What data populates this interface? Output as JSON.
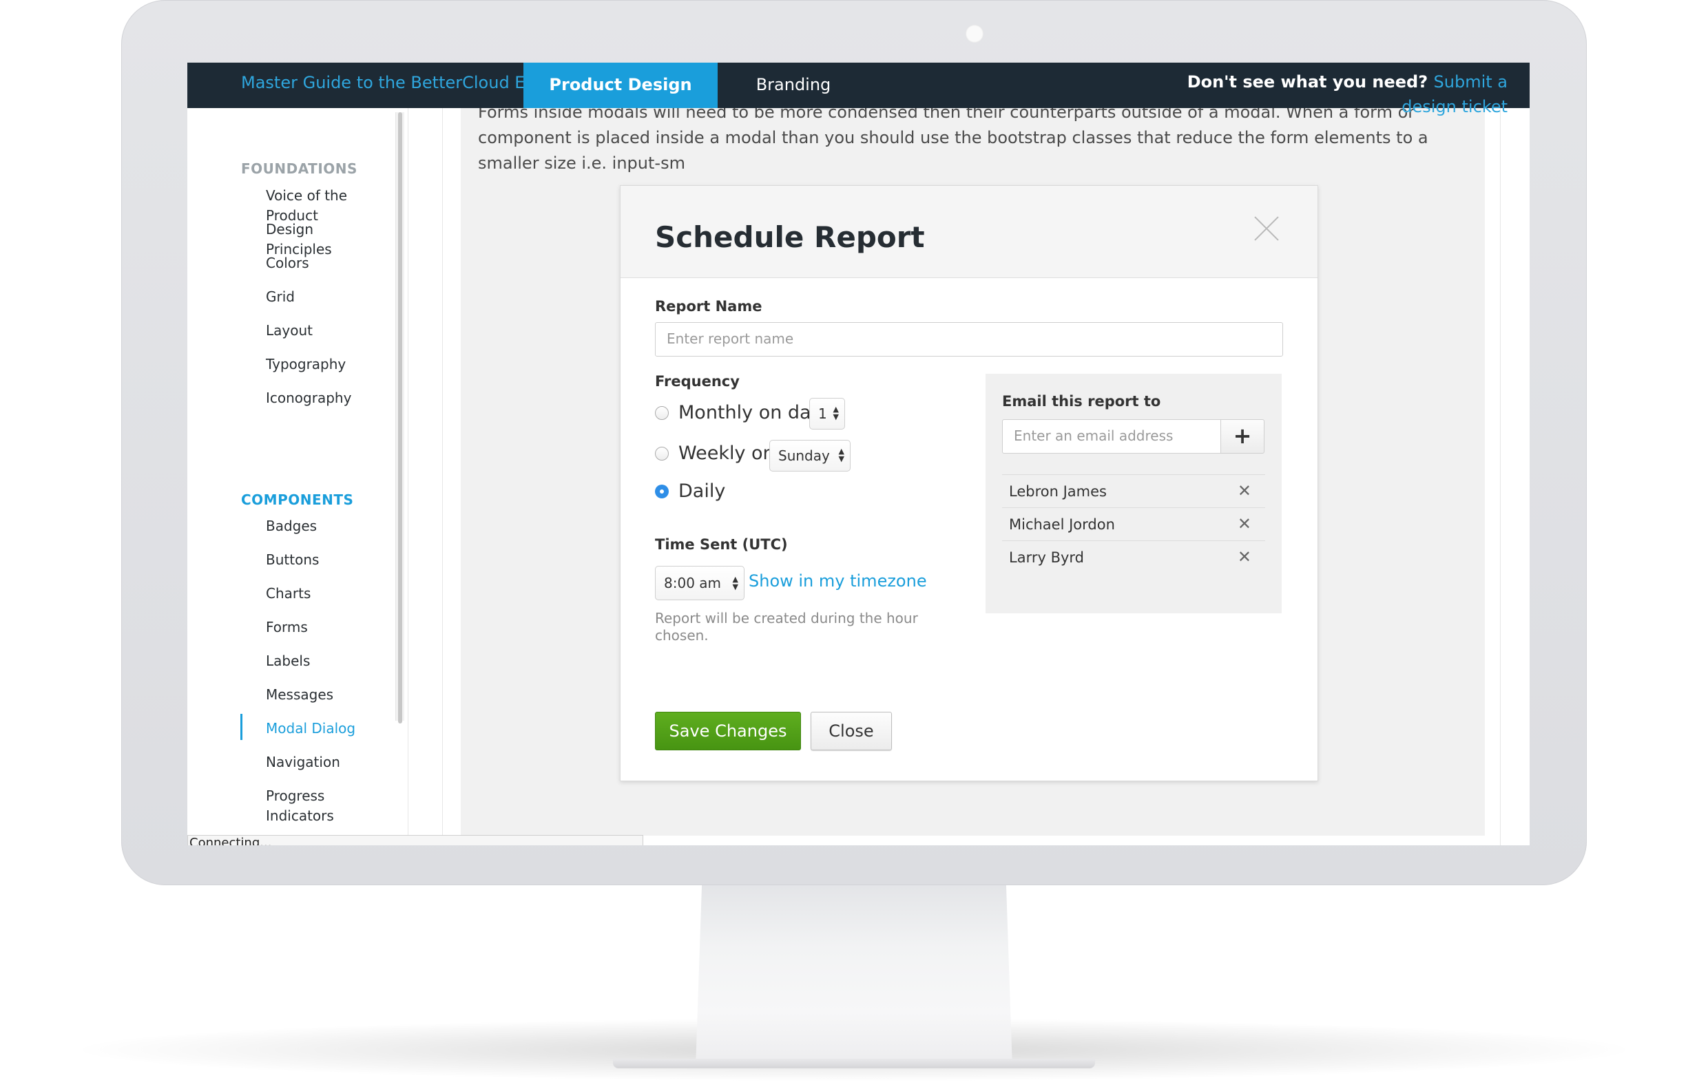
{
  "nav": {
    "master_link": "Master Guide to the BetterCloud Experience",
    "active_tab": "Product Design",
    "tab_branding": "Branding",
    "help_text": "Don't see what you need? ",
    "help_link": "Submit a design ticket"
  },
  "sidebar": {
    "foundations_heading": "FOUNDATIONS",
    "foundations": [
      "Voice of the Product",
      "Design Principles",
      "Colors",
      "Grid",
      "Layout",
      "Typography",
      "Iconography"
    ],
    "components_heading": "COMPONENTS",
    "components": [
      "Badges",
      "Buttons",
      "Charts",
      "Forms",
      "Labels",
      "Messages",
      "Modal Dialog",
      "Navigation",
      "Progress Indicators"
    ],
    "active_item": "Modal Dialog"
  },
  "content": {
    "intro": "Forms inside modals will need to be more condensed then their counterparts outside of a modal. When a form or component is placed inside a modal than you should use the bootstrap classes that reduce the form elements to a smaller size i.e. input-sm"
  },
  "modal": {
    "title": "Schedule Report",
    "report_name_label": "Report Name",
    "report_name_placeholder": "Enter report name",
    "frequency_label": "Frequency",
    "monthly_label": "Monthly on day",
    "monthly_day": "1",
    "weekly_label": "Weekly on",
    "weekly_day": "Sunday",
    "daily_label": "Daily",
    "selected_frequency": "Daily",
    "time_label": "Time Sent (UTC)",
    "time_value": "8:00 am",
    "timezone_link": "Show in my timezone",
    "time_hint": "Report will be created during the hour chosen.",
    "email_label": "Email this report to",
    "email_placeholder": "Enter an email address",
    "add_symbol": "+",
    "recipients": [
      "Lebron James",
      "Michael Jordon",
      "Larry Byrd"
    ],
    "remove_symbol": "✕",
    "save_button": "Save Changes",
    "close_button": "Close"
  },
  "status_bar": "Connecting...",
  "colors": {
    "nav_bg": "#1d2a35",
    "accent": "#1a9edb",
    "primary_button": "#52a318",
    "radio_selected": "#2e8ee7"
  }
}
